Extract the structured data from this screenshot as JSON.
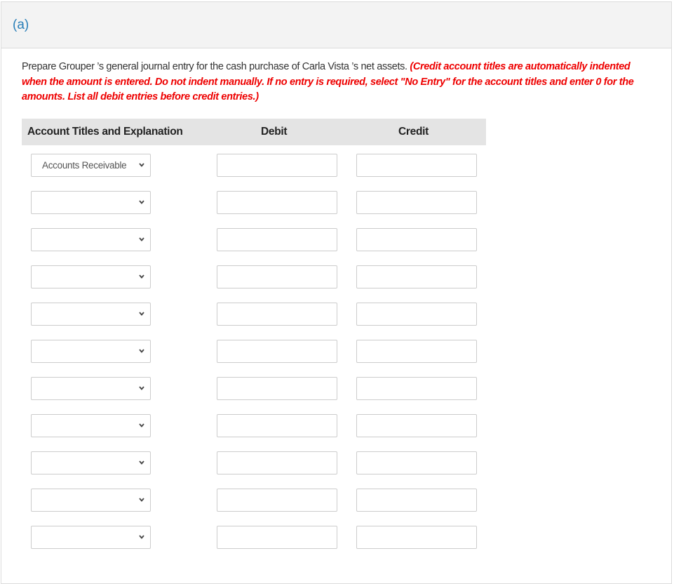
{
  "part": {
    "label": "(a)"
  },
  "instructions": {
    "text": "Prepare Grouper ’s general journal entry for the cash purchase of Carla Vista ’s net assets. ",
    "note": "(Credit account titles are automatically indented when the amount is entered. Do not indent manually. If no entry is required, select \"No Entry\" for the account titles and enter 0 for the amounts. List all debit entries before credit entries.)"
  },
  "table": {
    "headers": {
      "account": "Account Titles and Explanation",
      "debit": "Debit",
      "credit": "Credit"
    },
    "rows": [
      {
        "account": "Accounts Receivable",
        "debit": "",
        "credit": ""
      },
      {
        "account": "",
        "debit": "",
        "credit": ""
      },
      {
        "account": "",
        "debit": "",
        "credit": ""
      },
      {
        "account": "",
        "debit": "",
        "credit": ""
      },
      {
        "account": "",
        "debit": "",
        "credit": ""
      },
      {
        "account": "",
        "debit": "",
        "credit": ""
      },
      {
        "account": "",
        "debit": "",
        "credit": ""
      },
      {
        "account": "",
        "debit": "",
        "credit": ""
      },
      {
        "account": "",
        "debit": "",
        "credit": ""
      },
      {
        "account": "",
        "debit": "",
        "credit": ""
      },
      {
        "account": "",
        "debit": "",
        "credit": ""
      }
    ]
  },
  "colors": {
    "part_label": "#2a7fb8",
    "note": "#ee0000",
    "header_bg": "#f3f3f3",
    "table_head_bg": "#e4e4e4"
  }
}
